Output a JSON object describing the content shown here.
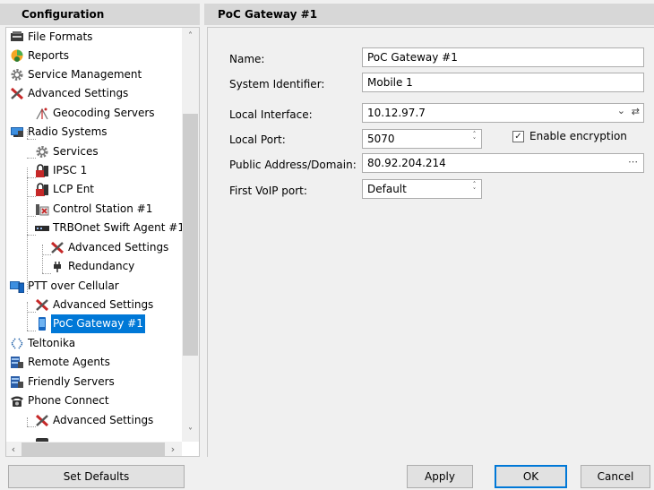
{
  "left_panel": {
    "title": "Configuration"
  },
  "tree": {
    "items": [
      {
        "label": "File Formats",
        "icon": "file-formats-icon"
      },
      {
        "label": "Reports",
        "icon": "reports-icon"
      },
      {
        "label": "Service Management",
        "icon": "gear-icon"
      },
      {
        "label": "Advanced Settings",
        "icon": "tools-icon"
      },
      {
        "label": "Geocoding Servers",
        "icon": "geocoding-icon"
      },
      {
        "label": "Radio Systems",
        "icon": "radio-systems-icon"
      },
      {
        "label": "Services",
        "icon": "gear-icon"
      },
      {
        "label": "IPSC 1",
        "icon": "locked-radio-icon"
      },
      {
        "label": "LCP Ent",
        "icon": "locked-radio-icon"
      },
      {
        "label": "Control Station #1",
        "icon": "control-station-icon"
      },
      {
        "label": "TRBOnet Swift Agent #1",
        "icon": "swift-agent-icon"
      },
      {
        "label": "Advanced Settings",
        "icon": "tools-icon"
      },
      {
        "label": "Redundancy",
        "icon": "plug-icon"
      },
      {
        "label": "PTT over Cellular",
        "icon": "ptt-cellular-icon"
      },
      {
        "label": "Advanced Settings",
        "icon": "tools-icon"
      },
      {
        "label": "PoC Gateway #1",
        "icon": "phone-icon",
        "selected": true
      },
      {
        "label": "Teltonika",
        "icon": "teltonika-icon"
      },
      {
        "label": "Remote Agents",
        "icon": "server-icon"
      },
      {
        "label": "Friendly Servers",
        "icon": "server-icon"
      },
      {
        "label": "Phone Connect",
        "icon": "telephone-icon"
      },
      {
        "label": "Advanced Settings",
        "icon": "tools-icon"
      }
    ]
  },
  "right_panel": {
    "title": "PoC Gateway #1",
    "fields": {
      "name": {
        "label": "Name:",
        "value": "PoC Gateway #1"
      },
      "system_identifier": {
        "label": "System Identifier:",
        "value": "Mobile 1"
      },
      "local_interface": {
        "label": "Local Interface:",
        "value": "10.12.97.7"
      },
      "local_port": {
        "label": "Local Port:",
        "value": "5070"
      },
      "enable_encryption": {
        "label": "Enable encryption",
        "checked": true
      },
      "public_address": {
        "label": "Public Address/Domain:",
        "value": "80.92.204.214"
      },
      "first_voip_port": {
        "label": "First VoIP port:",
        "value": "Default"
      }
    }
  },
  "buttons": {
    "set_defaults": "Set Defaults",
    "apply": "Apply",
    "ok": "OK",
    "cancel": "Cancel"
  },
  "colors": {
    "selection": "#0078d7",
    "header_bg": "#d7d7d7",
    "window_bg": "#f0f0f0"
  }
}
